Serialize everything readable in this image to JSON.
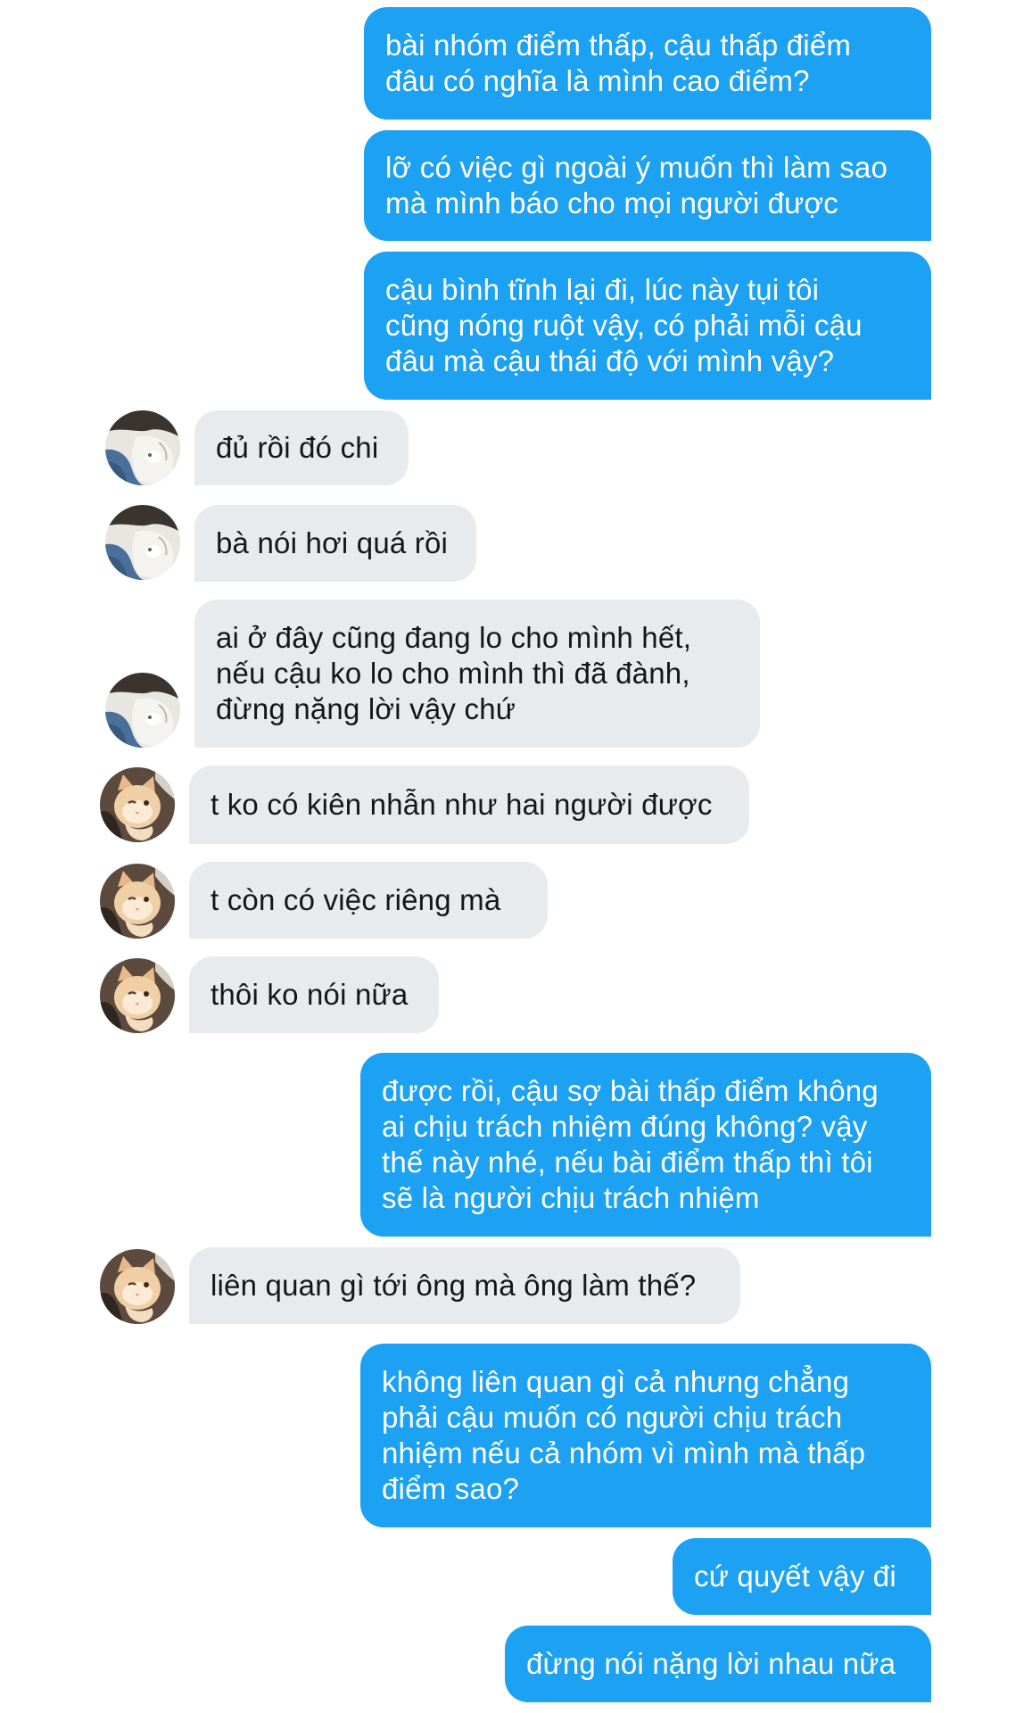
{
  "conversation": {
    "messages": [
      {
        "sender": "me",
        "text": "bài nhóm điểm thấp, cậu thấp điểm\nđâu có nghĩa là mình cao điểm?"
      },
      {
        "sender": "me",
        "text": "lỡ có việc gì ngoài ý muốn thì làm sao\nmà mình báo cho mọi người được"
      },
      {
        "sender": "me",
        "text": "cậu bình tĩnh lại đi, lúc này tụi tôi\ncũng nóng ruột vậy, có phải mỗi cậu\nđâu mà cậu thái độ với mình vậy?"
      },
      {
        "sender": "friend",
        "avatar": "person-avatar",
        "text": "đủ rồi đó chi"
      },
      {
        "sender": "friend",
        "avatar": "person-avatar",
        "text": "bà nói hơi quá rồi"
      },
      {
        "sender": "friend",
        "avatar": "person-avatar",
        "text": "ai ở đây cũng đang lo cho mình hết,\nnếu cậu ko lo cho mình thì đã đành,\nđừng nặng lời vậy chứ"
      },
      {
        "sender": "friend",
        "avatar": "cat-avatar",
        "text": "t ko có kiên nhẫn như hai người được"
      },
      {
        "sender": "friend",
        "avatar": "cat-avatar",
        "text": "t còn có việc riêng mà"
      },
      {
        "sender": "friend",
        "avatar": "cat-avatar",
        "text": "thôi ko nói nữa"
      },
      {
        "sender": "me",
        "text": "được rồi, cậu sợ bài thấp điểm không\nai chịu trách nhiệm đúng không? vậy\nthế này nhé, nếu bài điểm thấp thì tôi\nsẽ là người chịu trách nhiệm"
      },
      {
        "sender": "friend",
        "avatar": "cat-avatar",
        "text": "liên quan gì tới ông mà ông làm thế?"
      },
      {
        "sender": "me",
        "text": "không liên quan gì cả nhưng chẳng\nphải cậu muốn có người chịu trách\nnhiệm nếu cả nhóm vì mình mà thấp\nđiểm sao?"
      },
      {
        "sender": "me",
        "text": "cứ quyết vậy đi"
      },
      {
        "sender": "me",
        "text": "đừng nói nặng lời nhau nữa"
      }
    ]
  },
  "colors": {
    "outgoing_bubble": "#1da1f2",
    "incoming_bubble": "#e8ebee",
    "outgoing_text": "#ffffff",
    "incoming_text": "#14171a"
  }
}
